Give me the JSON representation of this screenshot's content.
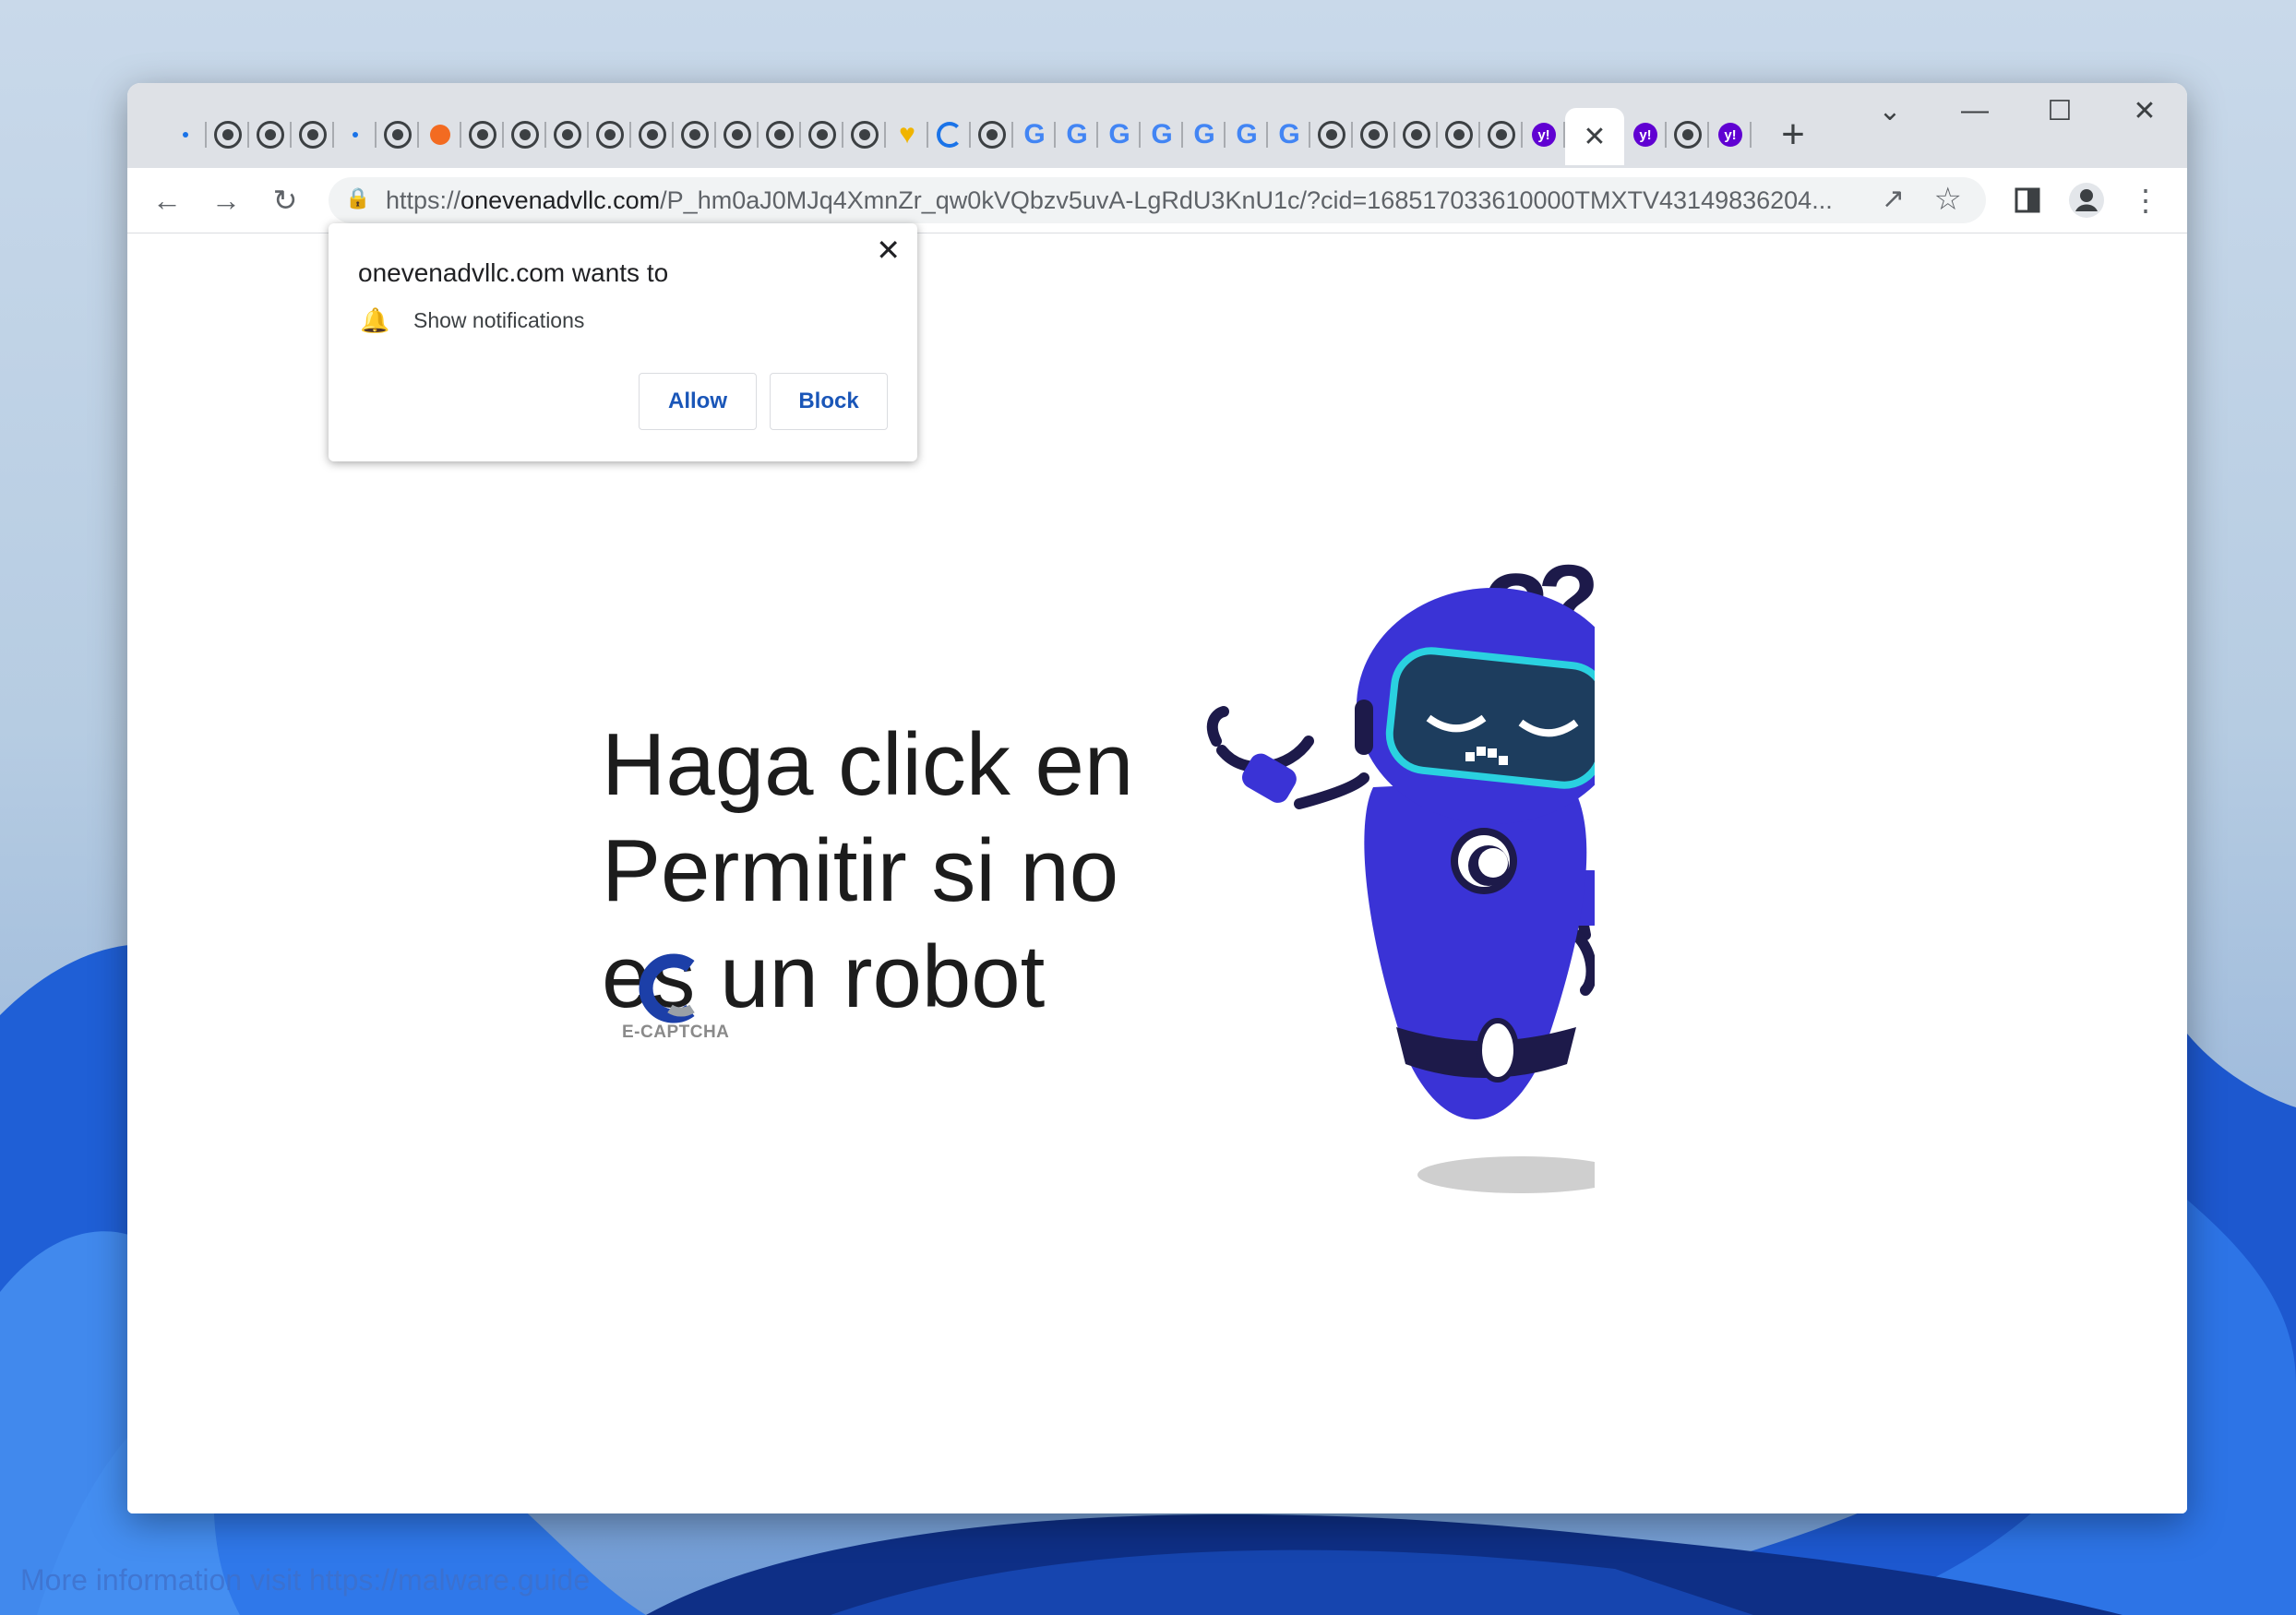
{
  "browser": {
    "url_prefix": "https://",
    "url_host": "onevenadvllc.com",
    "url_path": "/P_hm0aJ0MJq4XmnZr_qw0kVQbzv5uvA-LgRdU3KnU1c/?cid=168517033610000TMXTV43149836204..."
  },
  "tabs": [
    {
      "icon": "loading-dot-icon"
    },
    {
      "icon": "globe-icon"
    },
    {
      "icon": "globe-icon"
    },
    {
      "icon": "globe-icon"
    },
    {
      "icon": "loading-dot-icon"
    },
    {
      "icon": "globe-icon"
    },
    {
      "icon": "fire-icon"
    },
    {
      "icon": "globe-icon"
    },
    {
      "icon": "globe-icon"
    },
    {
      "icon": "globe-icon"
    },
    {
      "icon": "globe-icon"
    },
    {
      "icon": "globe-icon"
    },
    {
      "icon": "globe-icon"
    },
    {
      "icon": "globe-icon"
    },
    {
      "icon": "globe-icon"
    },
    {
      "icon": "globe-icon"
    },
    {
      "icon": "globe-icon"
    },
    {
      "icon": "heart-icon"
    },
    {
      "icon": "spinner-icon"
    },
    {
      "icon": "globe-icon"
    },
    {
      "icon": "google-icon"
    },
    {
      "icon": "google-icon"
    },
    {
      "icon": "google-icon"
    },
    {
      "icon": "google-icon"
    },
    {
      "icon": "google-icon"
    },
    {
      "icon": "google-icon"
    },
    {
      "icon": "google-icon"
    },
    {
      "icon": "globe-icon"
    },
    {
      "icon": "globe-icon"
    },
    {
      "icon": "globe-icon"
    },
    {
      "icon": "globe-icon"
    },
    {
      "icon": "globe-icon"
    },
    {
      "icon": "yahoo-icon"
    },
    {
      "icon": "close-icon",
      "active": true
    },
    {
      "icon": "yahoo-icon"
    },
    {
      "icon": "globe-icon"
    },
    {
      "icon": "yahoo-icon"
    }
  ],
  "popup": {
    "title": "onevenadvllc.com wants to",
    "permission": "Show notifications",
    "allow_label": "Allow",
    "block_label": "Block"
  },
  "page": {
    "headline_line1": "Haga click en",
    "headline_line2": "Permitir si no",
    "headline_line3": "es un robot",
    "logo_label": "E-CAPTCHA"
  },
  "watermark": "More information visit https://malware.guide",
  "colors": {
    "robot_body": "#3a33d6",
    "robot_dark": "#1d1a4a",
    "visor": "#2ad1e0",
    "link_blue": "#1a56b8"
  }
}
